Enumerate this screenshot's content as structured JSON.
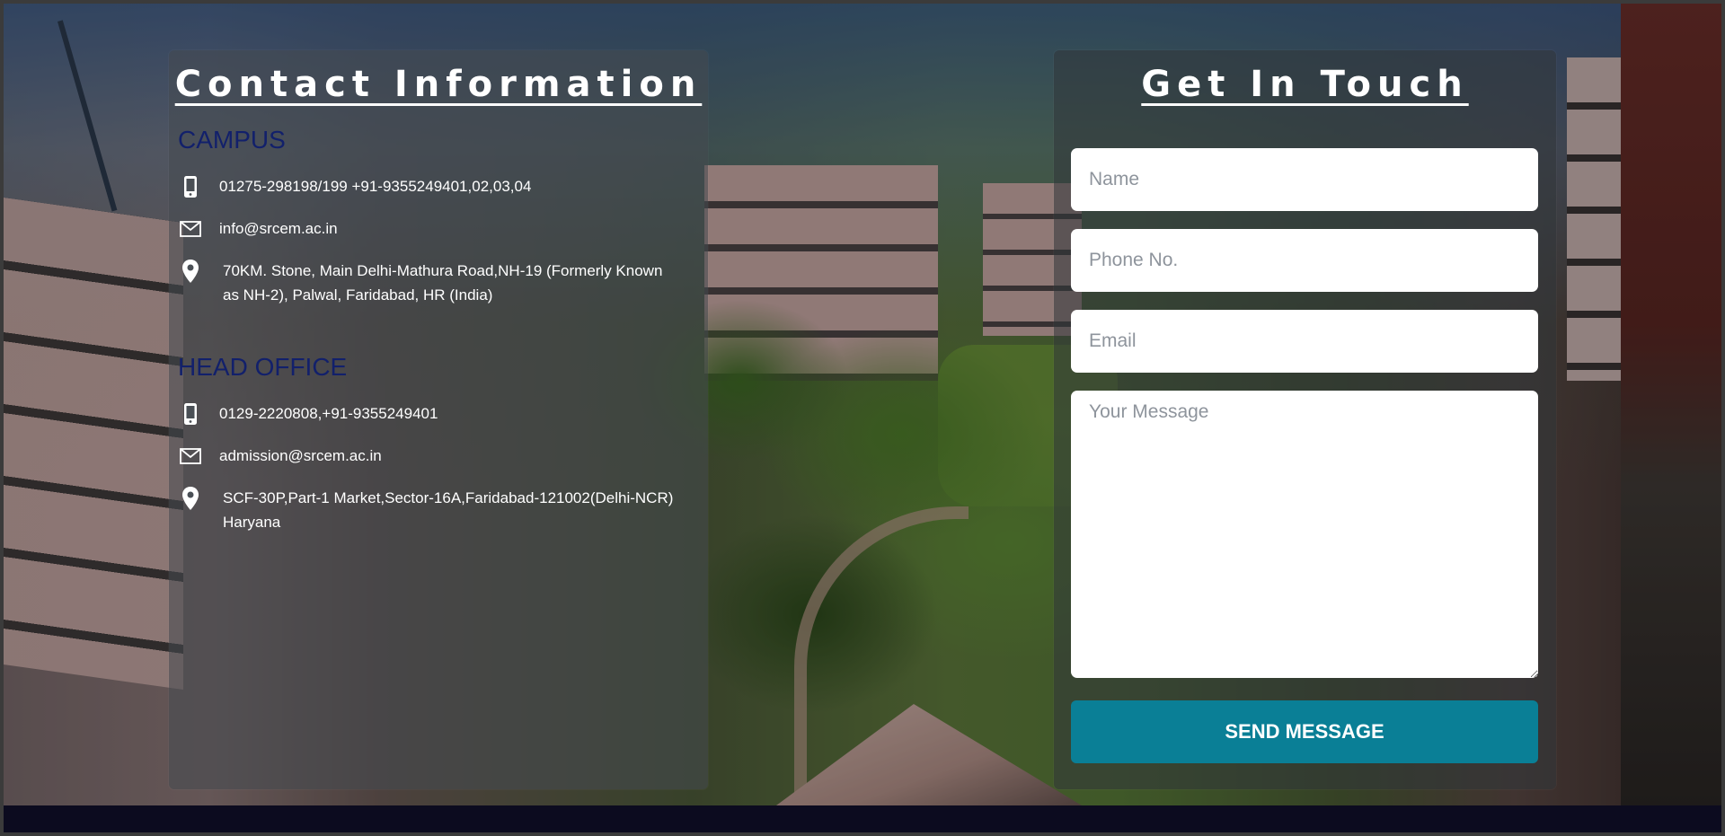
{
  "contact_info": {
    "title": "Contact Information",
    "campus": {
      "heading": "CAMPUS",
      "phone": "01275-298198/199 +91-9355249401,02,03,04",
      "email": "info@srcem.ac.in",
      "address_line1": "70KM. Stone, Main Delhi-Mathura Road,NH-19 (Formerly Known",
      "address_line2": "as NH-2), Palwal, Faridabad, HR (India)"
    },
    "head_office": {
      "heading": "HEAD OFFICE",
      "phone": "0129-2220808,+91-9355249401",
      "email": "admission@srcem.ac.in",
      "address_line1": "SCF-30P,Part-1 Market,Sector-16A,Faridabad-121002(Delhi-NCR)",
      "address_line2": "Haryana"
    }
  },
  "contact_form": {
    "title": "Get In Touch",
    "name_placeholder": "Name",
    "phone_placeholder": "Phone No.",
    "email_placeholder": "Email",
    "message_placeholder": "Your Message",
    "submit_label": "SEND MESSAGE"
  },
  "icons": {
    "phone": "mobile-phone-icon",
    "email": "envelope-icon",
    "address": "map-pin-icon"
  },
  "colors": {
    "section_heading": "#12206b",
    "button": "#0a7f96",
    "footer": "#0c0b1f"
  }
}
